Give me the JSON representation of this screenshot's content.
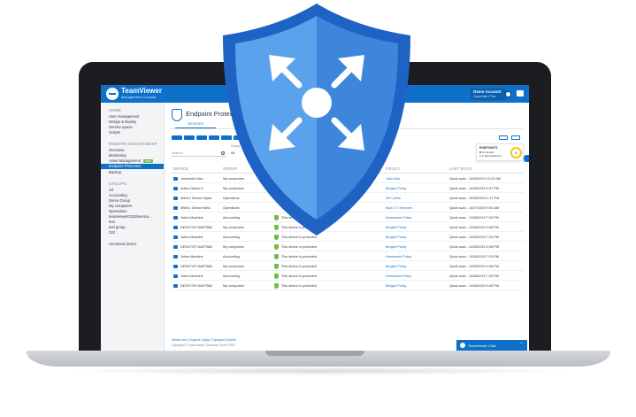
{
  "header": {
    "brand": "TeamViewer",
    "brand_sub": "Management Console",
    "account_name": "Demo Account",
    "account_role": "Corporate | Plus"
  },
  "sidebar": {
    "home_heading": "HOME",
    "home_items": [
      "User management",
      "Design & Deploy",
      "Service queue",
      "Scripts"
    ],
    "remote_heading": "REMOTE MANAGEMENT",
    "remote_items": [
      "Overview",
      "Monitoring",
      "Asset Management",
      "Endpoint Protection",
      "Backup"
    ],
    "asset_badge": "NEW",
    "groups_heading": "GROUPS",
    "group_items": [
      "All",
      "Accounting",
      "Demo Group",
      "My computers",
      "Operations",
      "teamviewer0315\\\\venice...",
      "test",
      "test group",
      "222"
    ],
    "unnamed": "Unnamed device"
  },
  "main": {
    "page_title": "Endpoint Protection",
    "tab_devices": "DEVICES",
    "search_placeholder": "Search",
    "group_label": "Group",
    "group_value": "All",
    "endpoints_title": "ENDPOINTS",
    "endpoints_infected": "0 Infected",
    "endpoints_attention": "1 Need attention",
    "endpoints_count": "6",
    "columns": [
      "DEVICE",
      "GROUP",
      "POLICY",
      "LAST SCAN"
    ],
    "rows": [
      {
        "device": "Johnsmith Mac",
        "group": "My computers",
        "status": "",
        "policy": "John Mac",
        "scan": "Quick scan - 11/28/2019 12:02 AM"
      },
      {
        "device": "Arthur Dhimo II",
        "group": "My computers",
        "status": "",
        "policy": "Bergire Policy",
        "scan": "Quick scan - 11/28/2019 2:47 PM"
      },
      {
        "device": "Win8.1 Device Alpha",
        "group": "Operations",
        "status": "",
        "policy": "Vel Larfire",
        "scan": "Quick scan - 10/08/2019 2:17 PM"
      },
      {
        "device": "Win8.1 Device Beta",
        "group": "Operations",
        "status": "",
        "policy": "Bud 1 IT Services",
        "scan": "Quick scan - 10/07/2019 9:51 AM"
      },
      {
        "device": "Johns Machine",
        "group": "Accounting",
        "status": "This device is protected",
        "policy": "Homework Policy",
        "scan": "Quick scan - 11/28/2019 7:03 PM"
      },
      {
        "device": "DESKTOP-NAETB62",
        "group": "My computers",
        "status": "This device is protected",
        "policy": "Bergire Policy",
        "scan": "Quick scan - 11/28/2019 2:08 PM"
      },
      {
        "device": "Johns Machine",
        "group": "Accounting",
        "status": "This device is protected",
        "policy": "Bergire Policy",
        "scan": "Quick scan - 11/28/2019 7:03 PM"
      },
      {
        "device": "DESKTOP-NAETB62",
        "group": "My computers",
        "status": "This device is protected",
        "policy": "Bergire Policy",
        "scan": "Quick scan - 11/28/2019 2:08 PM"
      },
      {
        "device": "Johns Machine",
        "group": "Accounting",
        "status": "This device is protected",
        "policy": "Homework Policy",
        "scan": "Quick scan - 11/28/2019 7:03 PM"
      },
      {
        "device": "DESKTOP-NAETB62",
        "group": "My computers",
        "status": "This device is protected",
        "policy": "Bergire Policy",
        "scan": "Quick scan - 11/28/2019 2:08 PM"
      },
      {
        "device": "Johns Machine",
        "group": "Accounting",
        "status": "This device is protected",
        "policy": "Homework Policy",
        "scan": "Quick scan - 11/28/2019 7:03 PM"
      },
      {
        "device": "DESKTOP-NAETB62",
        "group": "My computers",
        "status": "This device is protected",
        "policy": "Bergire Policy",
        "scan": "Quick scan - 11/28/2019 2:08 PM"
      }
    ]
  },
  "footer": {
    "links": "What's new  |  Support  |  Apps  |  Copyright  |  Imprint",
    "copyright": "Copyright © TeamViewer Germany GmbH 2019"
  },
  "chat": {
    "label": "TeamViewer Chat",
    "minimize": "−"
  },
  "colors": {
    "brand_blue": "#0e70c9",
    "shield_light": "#5aa2ec",
    "shield_dark": "#1e63c4",
    "ok_green": "#6fbe44"
  },
  "icons": {
    "shield": "shield-arrows-icon",
    "device": "monitor-icon",
    "status": "shield-check-icon"
  }
}
